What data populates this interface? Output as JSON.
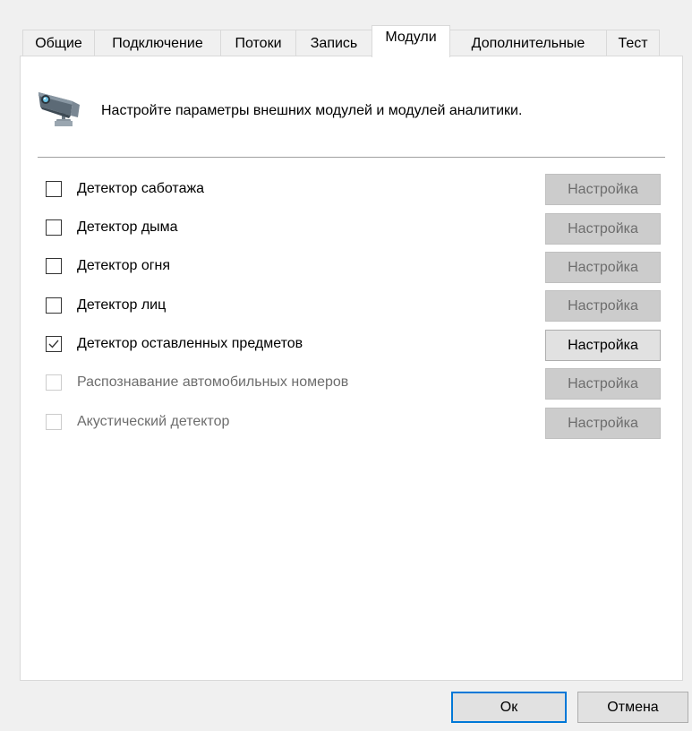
{
  "tabs": [
    {
      "label": "Общие",
      "active": false
    },
    {
      "label": "Подключение",
      "active": false
    },
    {
      "label": "Потоки",
      "active": false
    },
    {
      "label": "Запись",
      "active": false
    },
    {
      "label": "Модули",
      "active": true
    },
    {
      "label": "Дополнительные",
      "active": false
    },
    {
      "label": "Тест",
      "active": false
    }
  ],
  "header": {
    "icon": "security-camera-icon",
    "text": "Настройте параметры внешних модулей и модулей аналитики."
  },
  "modules": [
    {
      "label": "Детектор саботажа",
      "checked": false,
      "enabled": true,
      "button": "Настройка",
      "button_enabled": false
    },
    {
      "label": "Детектор дыма",
      "checked": false,
      "enabled": true,
      "button": "Настройка",
      "button_enabled": false
    },
    {
      "label": "Детектор огня",
      "checked": false,
      "enabled": true,
      "button": "Настройка",
      "button_enabled": false
    },
    {
      "label": "Детектор лиц",
      "checked": false,
      "enabled": true,
      "button": "Настройка",
      "button_enabled": false
    },
    {
      "label": "Детектор оставленных предметов",
      "checked": true,
      "enabled": true,
      "button": "Настройка",
      "button_enabled": true
    },
    {
      "label": "Распознавание автомобильных номеров",
      "checked": false,
      "enabled": false,
      "button": "Настройка",
      "button_enabled": false
    },
    {
      "label": "Акустический детектор",
      "checked": false,
      "enabled": false,
      "button": "Настройка",
      "button_enabled": false
    }
  ],
  "footer": {
    "ok_label": "Ок",
    "cancel_label": "Отмена"
  },
  "colors": {
    "focus_border": "#0078d7",
    "disabled_button": "#cccccc",
    "enabled_button": "#e1e1e1",
    "disabled_text": "#6d6d6d"
  }
}
